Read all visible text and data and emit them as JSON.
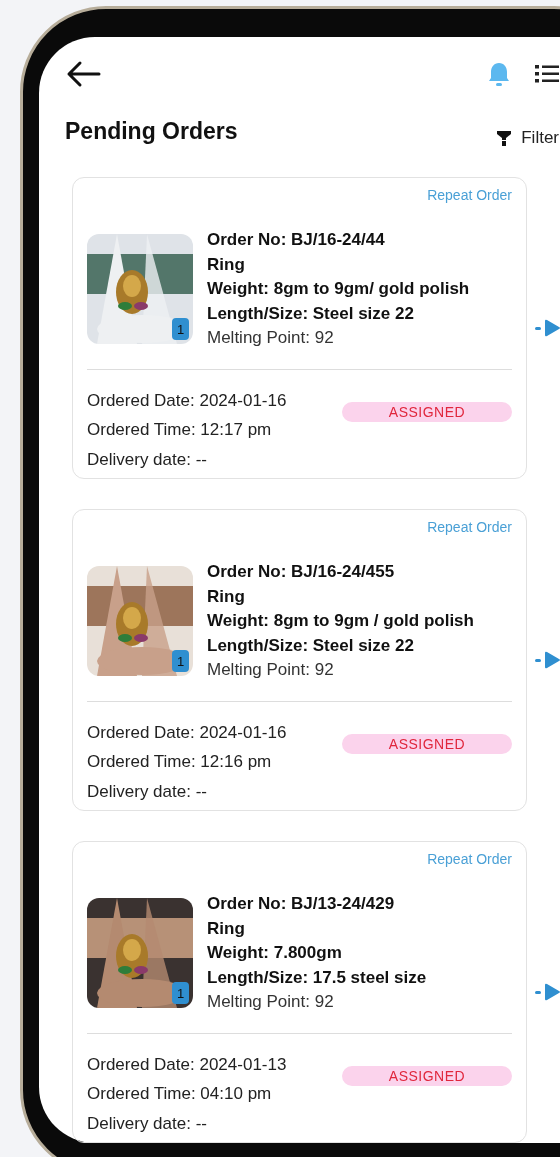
{
  "header": {
    "title": "Pending Orders",
    "filter_label": "Filter"
  },
  "orders": [
    {
      "repeat_label": "Repeat Order",
      "image_count": "1",
      "order_no": "Order No: BJ/16-24/44",
      "item": "Ring",
      "weight": "Weight: 8gm to 9gm/ gold polish",
      "size": "Length/Size: Steel size 22",
      "melting_point": "Melting Point: 92",
      "ordered_date": "Ordered Date: 2024-01-16",
      "ordered_time": "Ordered Time: 12:17 pm",
      "delivery_date": "Delivery date: --",
      "status": "ASSIGNED"
    },
    {
      "repeat_label": "Repeat Order",
      "image_count": "1",
      "order_no": "Order No: BJ/16-24/455",
      "item": "Ring",
      "weight": "Weight: 8gm to 9gm / gold polish",
      "size": "Length/Size: Steel size 22",
      "melting_point": "Melting Point: 92",
      "ordered_date": "Ordered Date: 2024-01-16",
      "ordered_time": "Ordered Time: 12:16 pm",
      "delivery_date": "Delivery date: --",
      "status": "ASSIGNED"
    },
    {
      "repeat_label": "Repeat Order",
      "image_count": "1",
      "order_no": "Order No: BJ/13-24/429",
      "item": "Ring",
      "weight": "Weight: 7.800gm",
      "size": "Length/Size: 17.5 steel size",
      "melting_point": "Melting Point: 92",
      "ordered_date": "Ordered Date: 2024-01-13",
      "ordered_time": "Ordered Time: 04:10 pm",
      "delivery_date": "Delivery date: --",
      "status": "ASSIGNED"
    }
  ]
}
